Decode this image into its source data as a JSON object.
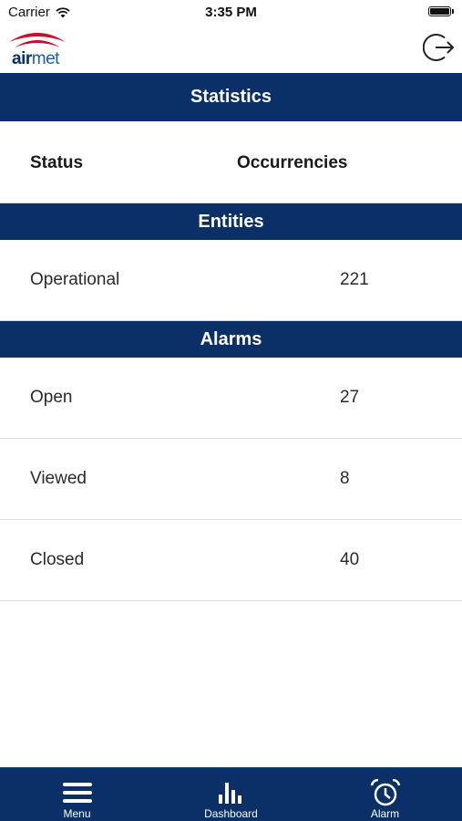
{
  "status_bar": {
    "carrier": "Carrier",
    "time": "3:35 PM",
    "wifi_icon": "wifi-icon",
    "battery_icon": "battery-icon"
  },
  "header": {
    "logo_text_part1": "air",
    "logo_text_part2": "met",
    "logout_icon": "logout-icon"
  },
  "title": "Statistics",
  "columns": {
    "status": "Status",
    "occurrencies": "Occurrencies"
  },
  "sections": [
    {
      "title": "Entities",
      "rows": [
        {
          "label": "Operational",
          "value": "221"
        }
      ]
    },
    {
      "title": "Alarms",
      "rows": [
        {
          "label": "Open",
          "value": "27"
        },
        {
          "label": "Viewed",
          "value": "8"
        },
        {
          "label": "Closed",
          "value": "40"
        }
      ]
    }
  ],
  "tab_bar": {
    "items": [
      {
        "label": "Menu",
        "icon": "menu-icon"
      },
      {
        "label": "Dashboard",
        "icon": "bar-chart-icon"
      },
      {
        "label": "Alarm",
        "icon": "alarm-clock-icon"
      }
    ]
  },
  "colors": {
    "primary": "#0b3068",
    "logo_red": "#c8102e",
    "divider": "#dcdcdc"
  }
}
